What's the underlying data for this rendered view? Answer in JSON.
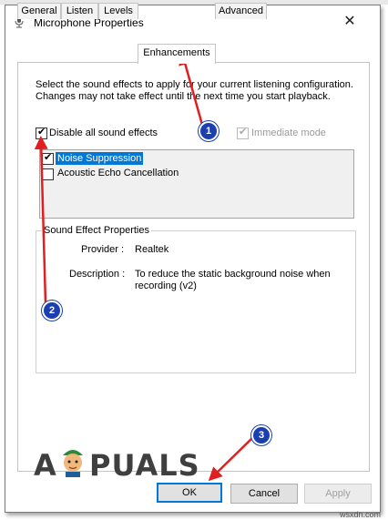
{
  "window": {
    "title": "Microphone Properties",
    "close_glyph": "✕"
  },
  "tabs": [
    {
      "label": "General"
    },
    {
      "label": "Listen"
    },
    {
      "label": "Levels"
    },
    {
      "label": "Enhancements",
      "active": true
    },
    {
      "label": "Advanced"
    }
  ],
  "enhancements": {
    "description": "Select the sound effects to apply for your current listening configuration. Changes may not take effect until the next time you start playback.",
    "disable_all_label": "Disable all sound effects",
    "disable_all_checked": true,
    "immediate_mode_label": "Immediate mode",
    "immediate_mode_checked": true,
    "effects": [
      {
        "label": "Noise Suppression",
        "checked": true,
        "selected": true
      },
      {
        "label": "Acoustic Echo Cancellation",
        "checked": false
      }
    ]
  },
  "properties": {
    "group_title": "Sound Effect Properties",
    "provider_label": "Provider :",
    "provider_value": "Realtek",
    "description_label": "Description :",
    "description_value": "To reduce the static background noise when recording (v2)"
  },
  "buttons": {
    "ok": "OK",
    "cancel": "Cancel",
    "apply": "Apply"
  },
  "annotations": {
    "step1": "1",
    "step2": "2",
    "step3": "3",
    "arrow_color": "#e02020",
    "badge_color": "#1b3fb0"
  },
  "branding": {
    "logo_left": "A",
    "logo_right": "PUALS",
    "watermark": "wsxdn.com"
  },
  "colors": {
    "selection": "#0078d7",
    "default_button_border": "#0078d7"
  }
}
